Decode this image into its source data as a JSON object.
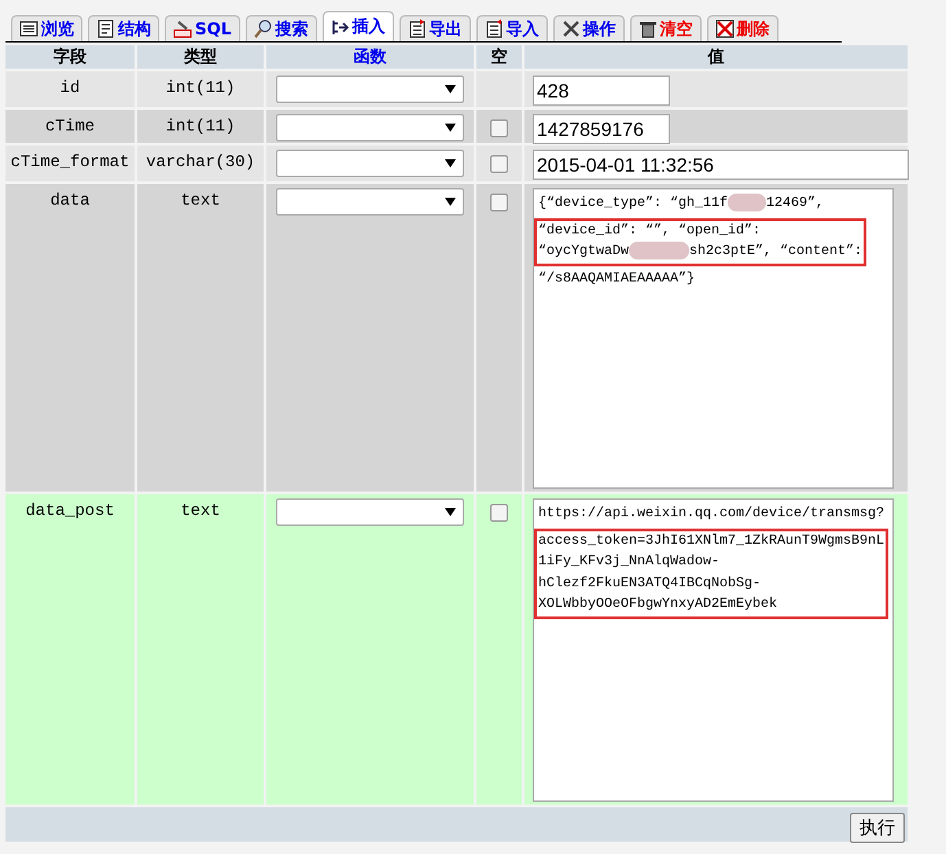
{
  "tabs": [
    {
      "label": "浏览",
      "color": "#0000ee",
      "selected": false
    },
    {
      "label": "结构",
      "color": "#0000ee",
      "selected": false
    },
    {
      "label": "SQL",
      "color": "#0000ee",
      "selected": false
    },
    {
      "label": "搜索",
      "color": "#0000ee",
      "selected": false
    },
    {
      "label": "插入",
      "color": "#0000ee",
      "selected": true
    },
    {
      "label": "导出",
      "color": "#0000ee",
      "selected": false
    },
    {
      "label": "导入",
      "color": "#0000ee",
      "selected": false
    },
    {
      "label": "操作",
      "color": "#0000ee",
      "selected": false
    },
    {
      "label": "清空",
      "color": "#ee0000",
      "selected": false
    },
    {
      "label": "删除",
      "color": "#ee0000",
      "selected": false
    }
  ],
  "table": {
    "columns": [
      {
        "label": "字段",
        "link": false
      },
      {
        "label": "类型",
        "link": false
      },
      {
        "label": "函数",
        "link": true
      },
      {
        "label": "空",
        "link": false
      },
      {
        "label": "值",
        "link": false
      }
    ],
    "rows": [
      {
        "field": "id",
        "type": "int(11)",
        "highlighted": false,
        "value": {
          "kind": "input",
          "text": "428"
        }
      },
      {
        "field": "cTime",
        "type": "int(11)",
        "null_checked": false,
        "highlighted": false,
        "value": {
          "kind": "input",
          "text": "1427859176"
        }
      },
      {
        "field": "cTime_format",
        "type": "varchar(30)",
        "null_checked": false,
        "highlighted": false,
        "value": {
          "kind": "wide-input",
          "text": "2015-04-01 11:32:56"
        }
      },
      {
        "field": "data",
        "type": "text",
        "null_checked": false,
        "highlighted": false,
        "value": {
          "kind": "textarea",
          "blocks": [
            {
              "boxed": false,
              "lines": [
                [
                  {
                    "kind": "text",
                    "text": "{“device_type”: “gh_11f"
                  },
                  {
                    "kind": "blur"
                  },
                  {
                    "kind": "text",
                    "text": "12469”,"
                  }
                ]
              ]
            },
            {
              "boxed": true,
              "lines": [
                [
                  {
                    "kind": "text",
                    "text": "“device_id”: “”, “open_id”:"
                  }
                ],
                [
                  {
                    "kind": "text",
                    "text": "“oycYgtwaDw"
                  },
                  {
                    "kind": "blur"
                  },
                  {
                    "kind": "text",
                    "text": "sh2c3ptE”, “content”:"
                  }
                ]
              ]
            },
            {
              "boxed": false,
              "lines": [
                [
                  {
                    "kind": "text",
                    "text": "“/s8AAQAMIAEAAAAA”}"
                  }
                ]
              ]
            }
          ]
        }
      },
      {
        "field": "data_post",
        "type": "text",
        "null_checked": false,
        "highlighted": true,
        "value": {
          "kind": "textarea",
          "blocks": [
            {
              "boxed": false,
              "lines": [
                [
                  {
                    "kind": "text",
                    "text": "https://api.weixin.qq.com/device/transmsg?"
                  }
                ]
              ]
            },
            {
              "boxed": true,
              "lines": [
                [
                  {
                    "kind": "text",
                    "text": "access_token=3JhI61XNlm7_1ZkRAunT9WgmsB9nL"
                  }
                ],
                [
                  {
                    "kind": "text",
                    "text": "1iFy_KFv3j_NnAlqWadow-"
                  }
                ],
                [
                  {
                    "kind": "text",
                    "text": "hClezf2FkuEN3ATQ4IBCqNobSg-"
                  }
                ],
                [
                  {
                    "kind": "text",
                    "text": "XOLWbbyOOeOFbgwYnxyAD2EmEybek"
                  }
                ]
              ]
            }
          ]
        }
      }
    ],
    "submit": "执行"
  }
}
